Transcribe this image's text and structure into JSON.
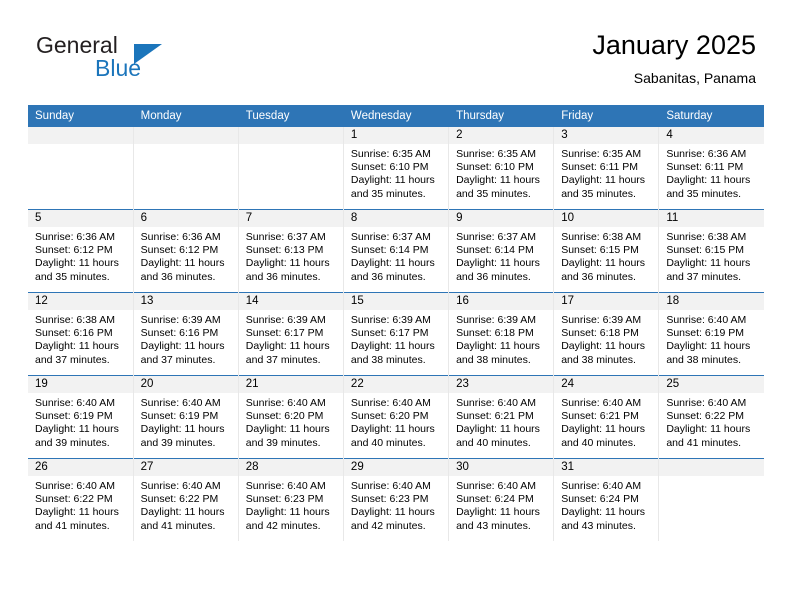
{
  "brand": {
    "name_top": "General",
    "name_bottom": "Blue",
    "color_dark": "#231f20",
    "color_blue": "#1b75bb"
  },
  "header": {
    "title": "January 2025",
    "subtitle": "Sabanitas, Panama"
  },
  "theme": {
    "header_blue": "#2e75b6",
    "daynum_band": "#f2f2f2",
    "cell_bg": "#ffffff",
    "text": "#000000"
  },
  "weekday_headers": [
    "Sunday",
    "Monday",
    "Tuesday",
    "Wednesday",
    "Thursday",
    "Friday",
    "Saturday"
  ],
  "weeks": [
    [
      {
        "day": "",
        "sunrise": "",
        "sunset": "",
        "daylight_line1": "",
        "daylight_line2": ""
      },
      {
        "day": "",
        "sunrise": "",
        "sunset": "",
        "daylight_line1": "",
        "daylight_line2": ""
      },
      {
        "day": "",
        "sunrise": "",
        "sunset": "",
        "daylight_line1": "",
        "daylight_line2": ""
      },
      {
        "day": "1",
        "sunrise": "Sunrise: 6:35 AM",
        "sunset": "Sunset: 6:10 PM",
        "daylight_line1": "Daylight: 11 hours",
        "daylight_line2": "and 35 minutes."
      },
      {
        "day": "2",
        "sunrise": "Sunrise: 6:35 AM",
        "sunset": "Sunset: 6:10 PM",
        "daylight_line1": "Daylight: 11 hours",
        "daylight_line2": "and 35 minutes."
      },
      {
        "day": "3",
        "sunrise": "Sunrise: 6:35 AM",
        "sunset": "Sunset: 6:11 PM",
        "daylight_line1": "Daylight: 11 hours",
        "daylight_line2": "and 35 minutes."
      },
      {
        "day": "4",
        "sunrise": "Sunrise: 6:36 AM",
        "sunset": "Sunset: 6:11 PM",
        "daylight_line1": "Daylight: 11 hours",
        "daylight_line2": "and 35 minutes."
      }
    ],
    [
      {
        "day": "5",
        "sunrise": "Sunrise: 6:36 AM",
        "sunset": "Sunset: 6:12 PM",
        "daylight_line1": "Daylight: 11 hours",
        "daylight_line2": "and 35 minutes."
      },
      {
        "day": "6",
        "sunrise": "Sunrise: 6:36 AM",
        "sunset": "Sunset: 6:12 PM",
        "daylight_line1": "Daylight: 11 hours",
        "daylight_line2": "and 36 minutes."
      },
      {
        "day": "7",
        "sunrise": "Sunrise: 6:37 AM",
        "sunset": "Sunset: 6:13 PM",
        "daylight_line1": "Daylight: 11 hours",
        "daylight_line2": "and 36 minutes."
      },
      {
        "day": "8",
        "sunrise": "Sunrise: 6:37 AM",
        "sunset": "Sunset: 6:14 PM",
        "daylight_line1": "Daylight: 11 hours",
        "daylight_line2": "and 36 minutes."
      },
      {
        "day": "9",
        "sunrise": "Sunrise: 6:37 AM",
        "sunset": "Sunset: 6:14 PM",
        "daylight_line1": "Daylight: 11 hours",
        "daylight_line2": "and 36 minutes."
      },
      {
        "day": "10",
        "sunrise": "Sunrise: 6:38 AM",
        "sunset": "Sunset: 6:15 PM",
        "daylight_line1": "Daylight: 11 hours",
        "daylight_line2": "and 36 minutes."
      },
      {
        "day": "11",
        "sunrise": "Sunrise: 6:38 AM",
        "sunset": "Sunset: 6:15 PM",
        "daylight_line1": "Daylight: 11 hours",
        "daylight_line2": "and 37 minutes."
      }
    ],
    [
      {
        "day": "12",
        "sunrise": "Sunrise: 6:38 AM",
        "sunset": "Sunset: 6:16 PM",
        "daylight_line1": "Daylight: 11 hours",
        "daylight_line2": "and 37 minutes."
      },
      {
        "day": "13",
        "sunrise": "Sunrise: 6:39 AM",
        "sunset": "Sunset: 6:16 PM",
        "daylight_line1": "Daylight: 11 hours",
        "daylight_line2": "and 37 minutes."
      },
      {
        "day": "14",
        "sunrise": "Sunrise: 6:39 AM",
        "sunset": "Sunset: 6:17 PM",
        "daylight_line1": "Daylight: 11 hours",
        "daylight_line2": "and 37 minutes."
      },
      {
        "day": "15",
        "sunrise": "Sunrise: 6:39 AM",
        "sunset": "Sunset: 6:17 PM",
        "daylight_line1": "Daylight: 11 hours",
        "daylight_line2": "and 38 minutes."
      },
      {
        "day": "16",
        "sunrise": "Sunrise: 6:39 AM",
        "sunset": "Sunset: 6:18 PM",
        "daylight_line1": "Daylight: 11 hours",
        "daylight_line2": "and 38 minutes."
      },
      {
        "day": "17",
        "sunrise": "Sunrise: 6:39 AM",
        "sunset": "Sunset: 6:18 PM",
        "daylight_line1": "Daylight: 11 hours",
        "daylight_line2": "and 38 minutes."
      },
      {
        "day": "18",
        "sunrise": "Sunrise: 6:40 AM",
        "sunset": "Sunset: 6:19 PM",
        "daylight_line1": "Daylight: 11 hours",
        "daylight_line2": "and 38 minutes."
      }
    ],
    [
      {
        "day": "19",
        "sunrise": "Sunrise: 6:40 AM",
        "sunset": "Sunset: 6:19 PM",
        "daylight_line1": "Daylight: 11 hours",
        "daylight_line2": "and 39 minutes."
      },
      {
        "day": "20",
        "sunrise": "Sunrise: 6:40 AM",
        "sunset": "Sunset: 6:19 PM",
        "daylight_line1": "Daylight: 11 hours",
        "daylight_line2": "and 39 minutes."
      },
      {
        "day": "21",
        "sunrise": "Sunrise: 6:40 AM",
        "sunset": "Sunset: 6:20 PM",
        "daylight_line1": "Daylight: 11 hours",
        "daylight_line2": "and 39 minutes."
      },
      {
        "day": "22",
        "sunrise": "Sunrise: 6:40 AM",
        "sunset": "Sunset: 6:20 PM",
        "daylight_line1": "Daylight: 11 hours",
        "daylight_line2": "and 40 minutes."
      },
      {
        "day": "23",
        "sunrise": "Sunrise: 6:40 AM",
        "sunset": "Sunset: 6:21 PM",
        "daylight_line1": "Daylight: 11 hours",
        "daylight_line2": "and 40 minutes."
      },
      {
        "day": "24",
        "sunrise": "Sunrise: 6:40 AM",
        "sunset": "Sunset: 6:21 PM",
        "daylight_line1": "Daylight: 11 hours",
        "daylight_line2": "and 40 minutes."
      },
      {
        "day": "25",
        "sunrise": "Sunrise: 6:40 AM",
        "sunset": "Sunset: 6:22 PM",
        "daylight_line1": "Daylight: 11 hours",
        "daylight_line2": "and 41 minutes."
      }
    ],
    [
      {
        "day": "26",
        "sunrise": "Sunrise: 6:40 AM",
        "sunset": "Sunset: 6:22 PM",
        "daylight_line1": "Daylight: 11 hours",
        "daylight_line2": "and 41 minutes."
      },
      {
        "day": "27",
        "sunrise": "Sunrise: 6:40 AM",
        "sunset": "Sunset: 6:22 PM",
        "daylight_line1": "Daylight: 11 hours",
        "daylight_line2": "and 41 minutes."
      },
      {
        "day": "28",
        "sunrise": "Sunrise: 6:40 AM",
        "sunset": "Sunset: 6:23 PM",
        "daylight_line1": "Daylight: 11 hours",
        "daylight_line2": "and 42 minutes."
      },
      {
        "day": "29",
        "sunrise": "Sunrise: 6:40 AM",
        "sunset": "Sunset: 6:23 PM",
        "daylight_line1": "Daylight: 11 hours",
        "daylight_line2": "and 42 minutes."
      },
      {
        "day": "30",
        "sunrise": "Sunrise: 6:40 AM",
        "sunset": "Sunset: 6:24 PM",
        "daylight_line1": "Daylight: 11 hours",
        "daylight_line2": "and 43 minutes."
      },
      {
        "day": "31",
        "sunrise": "Sunrise: 6:40 AM",
        "sunset": "Sunset: 6:24 PM",
        "daylight_line1": "Daylight: 11 hours",
        "daylight_line2": "and 43 minutes."
      },
      {
        "day": "",
        "sunrise": "",
        "sunset": "",
        "daylight_line1": "",
        "daylight_line2": ""
      }
    ]
  ]
}
